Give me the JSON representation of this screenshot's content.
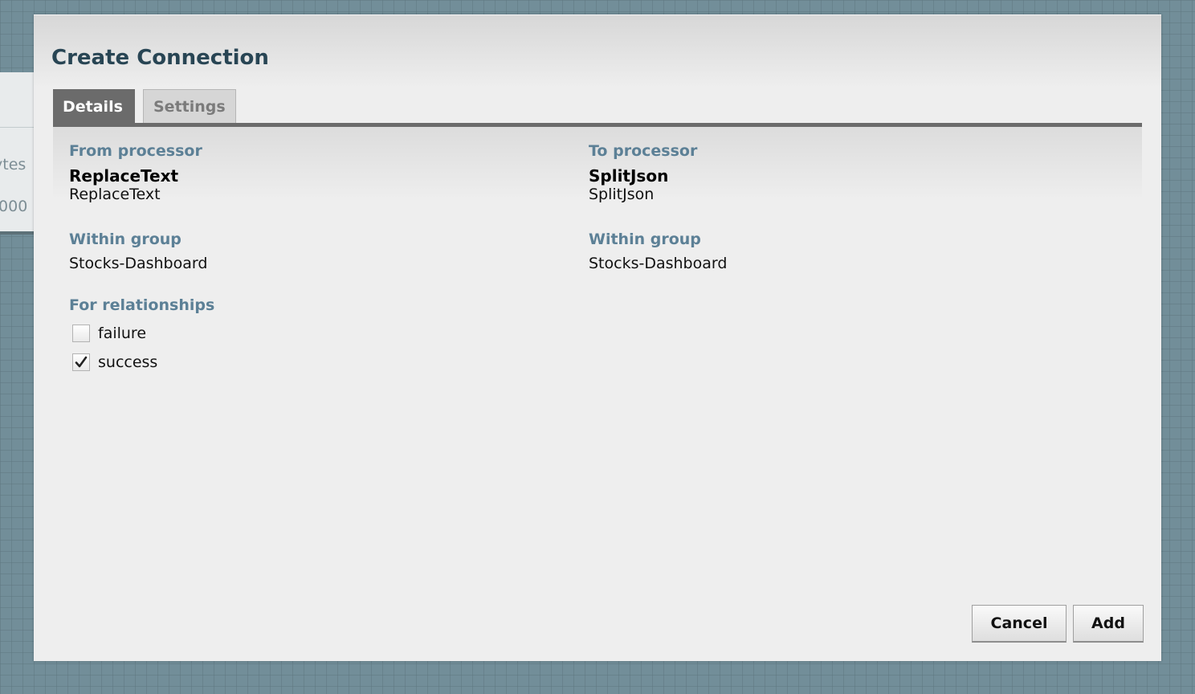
{
  "background": {
    "partial_texts": [
      "ytes",
      ".000"
    ]
  },
  "dialog": {
    "title": "Create Connection",
    "tabs": [
      {
        "label": "Details",
        "active": true
      },
      {
        "label": "Settings",
        "active": false
      }
    ],
    "from": {
      "label": "From processor",
      "name": "ReplaceText",
      "type": "ReplaceText",
      "group_label": "Within group",
      "group": "Stocks-Dashboard"
    },
    "to": {
      "label": "To processor",
      "name": "SplitJson",
      "type": "SplitJson",
      "group_label": "Within group",
      "group": "Stocks-Dashboard"
    },
    "relationships": {
      "label": "For relationships",
      "items": [
        {
          "label": "failure",
          "checked": false
        },
        {
          "label": "success",
          "checked": true
        }
      ]
    },
    "buttons": {
      "cancel": "Cancel",
      "add": "Add"
    }
  },
  "colors": {
    "canvas": "#728e99",
    "dialog_bg": "#eeeeee",
    "title": "#284554",
    "field_label": "#5c8096",
    "active_tab": "#6b6b6b"
  }
}
